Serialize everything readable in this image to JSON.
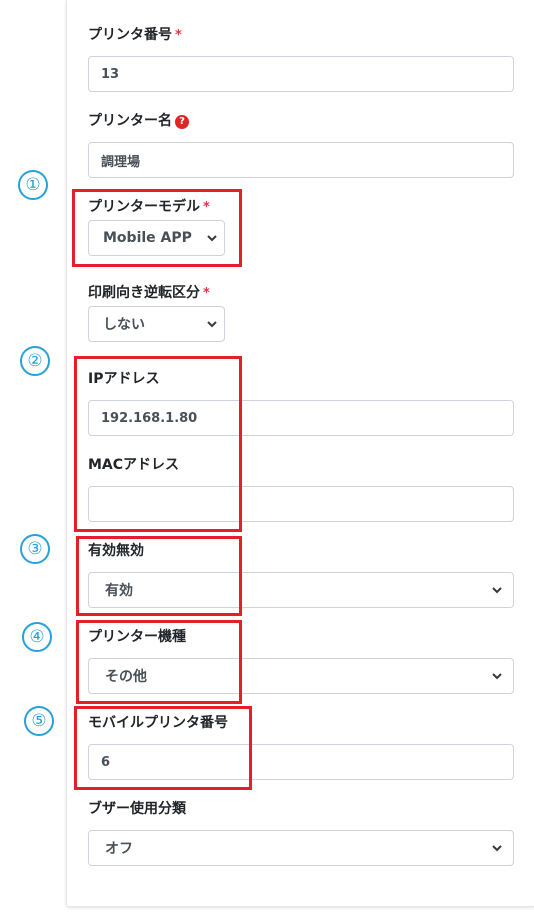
{
  "form": {
    "printer_number": {
      "label": "プリンタ番号",
      "required": "*",
      "value": "13"
    },
    "printer_name": {
      "label": "プリンター名",
      "help_icon": "?",
      "value": "調理場"
    },
    "printer_model": {
      "label": "プリンターモデル",
      "required": "*",
      "selected": "Mobile APP"
    },
    "print_reverse": {
      "label": "印刷向き逆転区分",
      "required": "*",
      "selected": "しない"
    },
    "ip_address": {
      "label": "IPアドレス",
      "value": "192.168.1.80"
    },
    "mac_address": {
      "label": "MACアドレス",
      "value": ""
    },
    "enabled": {
      "label": "有効無効",
      "selected": "有効"
    },
    "printer_type": {
      "label": "プリンター機種",
      "selected": "その他"
    },
    "mobile_printer_number": {
      "label": "モバイルプリンタ番号",
      "value": "6"
    },
    "buzzer": {
      "label": "ブザー使用分類",
      "selected": "オフ"
    }
  },
  "annotations": {
    "n1": "①",
    "n2": "②",
    "n3": "③",
    "n4": "④",
    "n5": "⑤",
    "circle_color": "#2aa0d8",
    "box_color": "#e41e2a"
  }
}
